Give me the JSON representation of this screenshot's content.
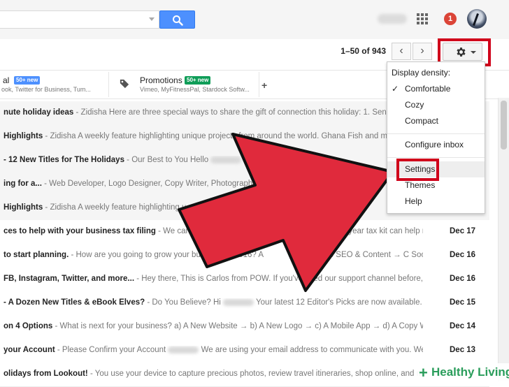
{
  "header": {
    "notifications_count": "1"
  },
  "toolbar": {
    "page_count": "1–50 of 943",
    "prev_glyph": "‹",
    "next_glyph": "›"
  },
  "tabs": [
    {
      "title": "al",
      "badge": "50+ new",
      "badge_color": "#4d90fe",
      "subtitle": "ook, Twitter for Business, Tum..."
    },
    {
      "title": "Promotions",
      "badge": "50+ new",
      "badge_color": "#0f9d58",
      "subtitle": "Vimeo, MyFitnessPal, Stardock Softw..."
    }
  ],
  "tab_add_glyph": "+",
  "emails": [
    {
      "subject": "nute holiday ideas",
      "snippet": " - Zidisha Here are three special ways to share the gift of connection this holiday: 1. Send a Zi",
      "date": ""
    },
    {
      "subject": "Highlights",
      "snippet": " - Zidisha A weekly feature highlighting unique projects from around the world. Ghana Fish and meat",
      "date": ""
    },
    {
      "subject": "- 12 New Titles for The Holidays",
      "snippet": " - Our Best to You Hello",
      "date": ""
    },
    {
      "subject": "ing for a...",
      "snippet": " - Web Developer, Logo Designer, Copy Writer, Photographer",
      "date": ""
    },
    {
      "subject": "Highlights",
      "snippet": " - Zidisha A weekly feature highlighting u",
      "date": ""
    },
    {
      "subject": "ces to help with your business tax filing",
      "snippet": " - We can guess you'll love ta",
      "date": "Dec 17",
      "tail": "end-of-year tax kit can help r"
    },
    {
      "subject": "to start planning.",
      "snippet": " - How are you going to grow your business in 2016? A",
      "date": "Dec 16",
      "tail": "rketing → B SEO & Content → C Soc"
    },
    {
      "subject": "FB, Instagram, Twitter, and more...",
      "snippet": " - Hey there, This is Carlos from POW. If you've used our support channel before, yo",
      "date": "Dec 16"
    },
    {
      "subject": "- A Dozen New Titles & eBook Elves?",
      "snippet": " - Do You Believe? Hi",
      "date": "Dec 15",
      "tail": " Your latest 12 Editor's Picks are now available. T"
    },
    {
      "subject": "on 4 Options",
      "snippet": " - What is next for your business? a) A New Website → b) A New Logo → c) A Mobile App → d) A Copy Wr",
      "date": "Dec 14"
    },
    {
      "subject": "your Account",
      "snippet": " - Please Confirm your Account",
      "date": "Dec 13",
      "tail": " We are using your email address to communicate with you. We wil"
    },
    {
      "subject": "olidays from Lookout!",
      "snippet": " - You use your device to capture precious photos, review travel itineraries, shop online, and mo",
      "date": ""
    }
  ],
  "menu": {
    "heading": "Display density:",
    "check_glyph": "✓",
    "items": [
      "Comfortable",
      "Cozy",
      "Compact",
      "Configure inbox",
      "Settings",
      "Themes",
      "Help"
    ]
  },
  "colors": {
    "highlight": "#d0021b",
    "arrow": "#e02a3c",
    "search_button": "#4d90fe",
    "watermark": "#2a9d5b"
  },
  "watermark": {
    "plus": "+",
    "text": "Healthy Living"
  }
}
